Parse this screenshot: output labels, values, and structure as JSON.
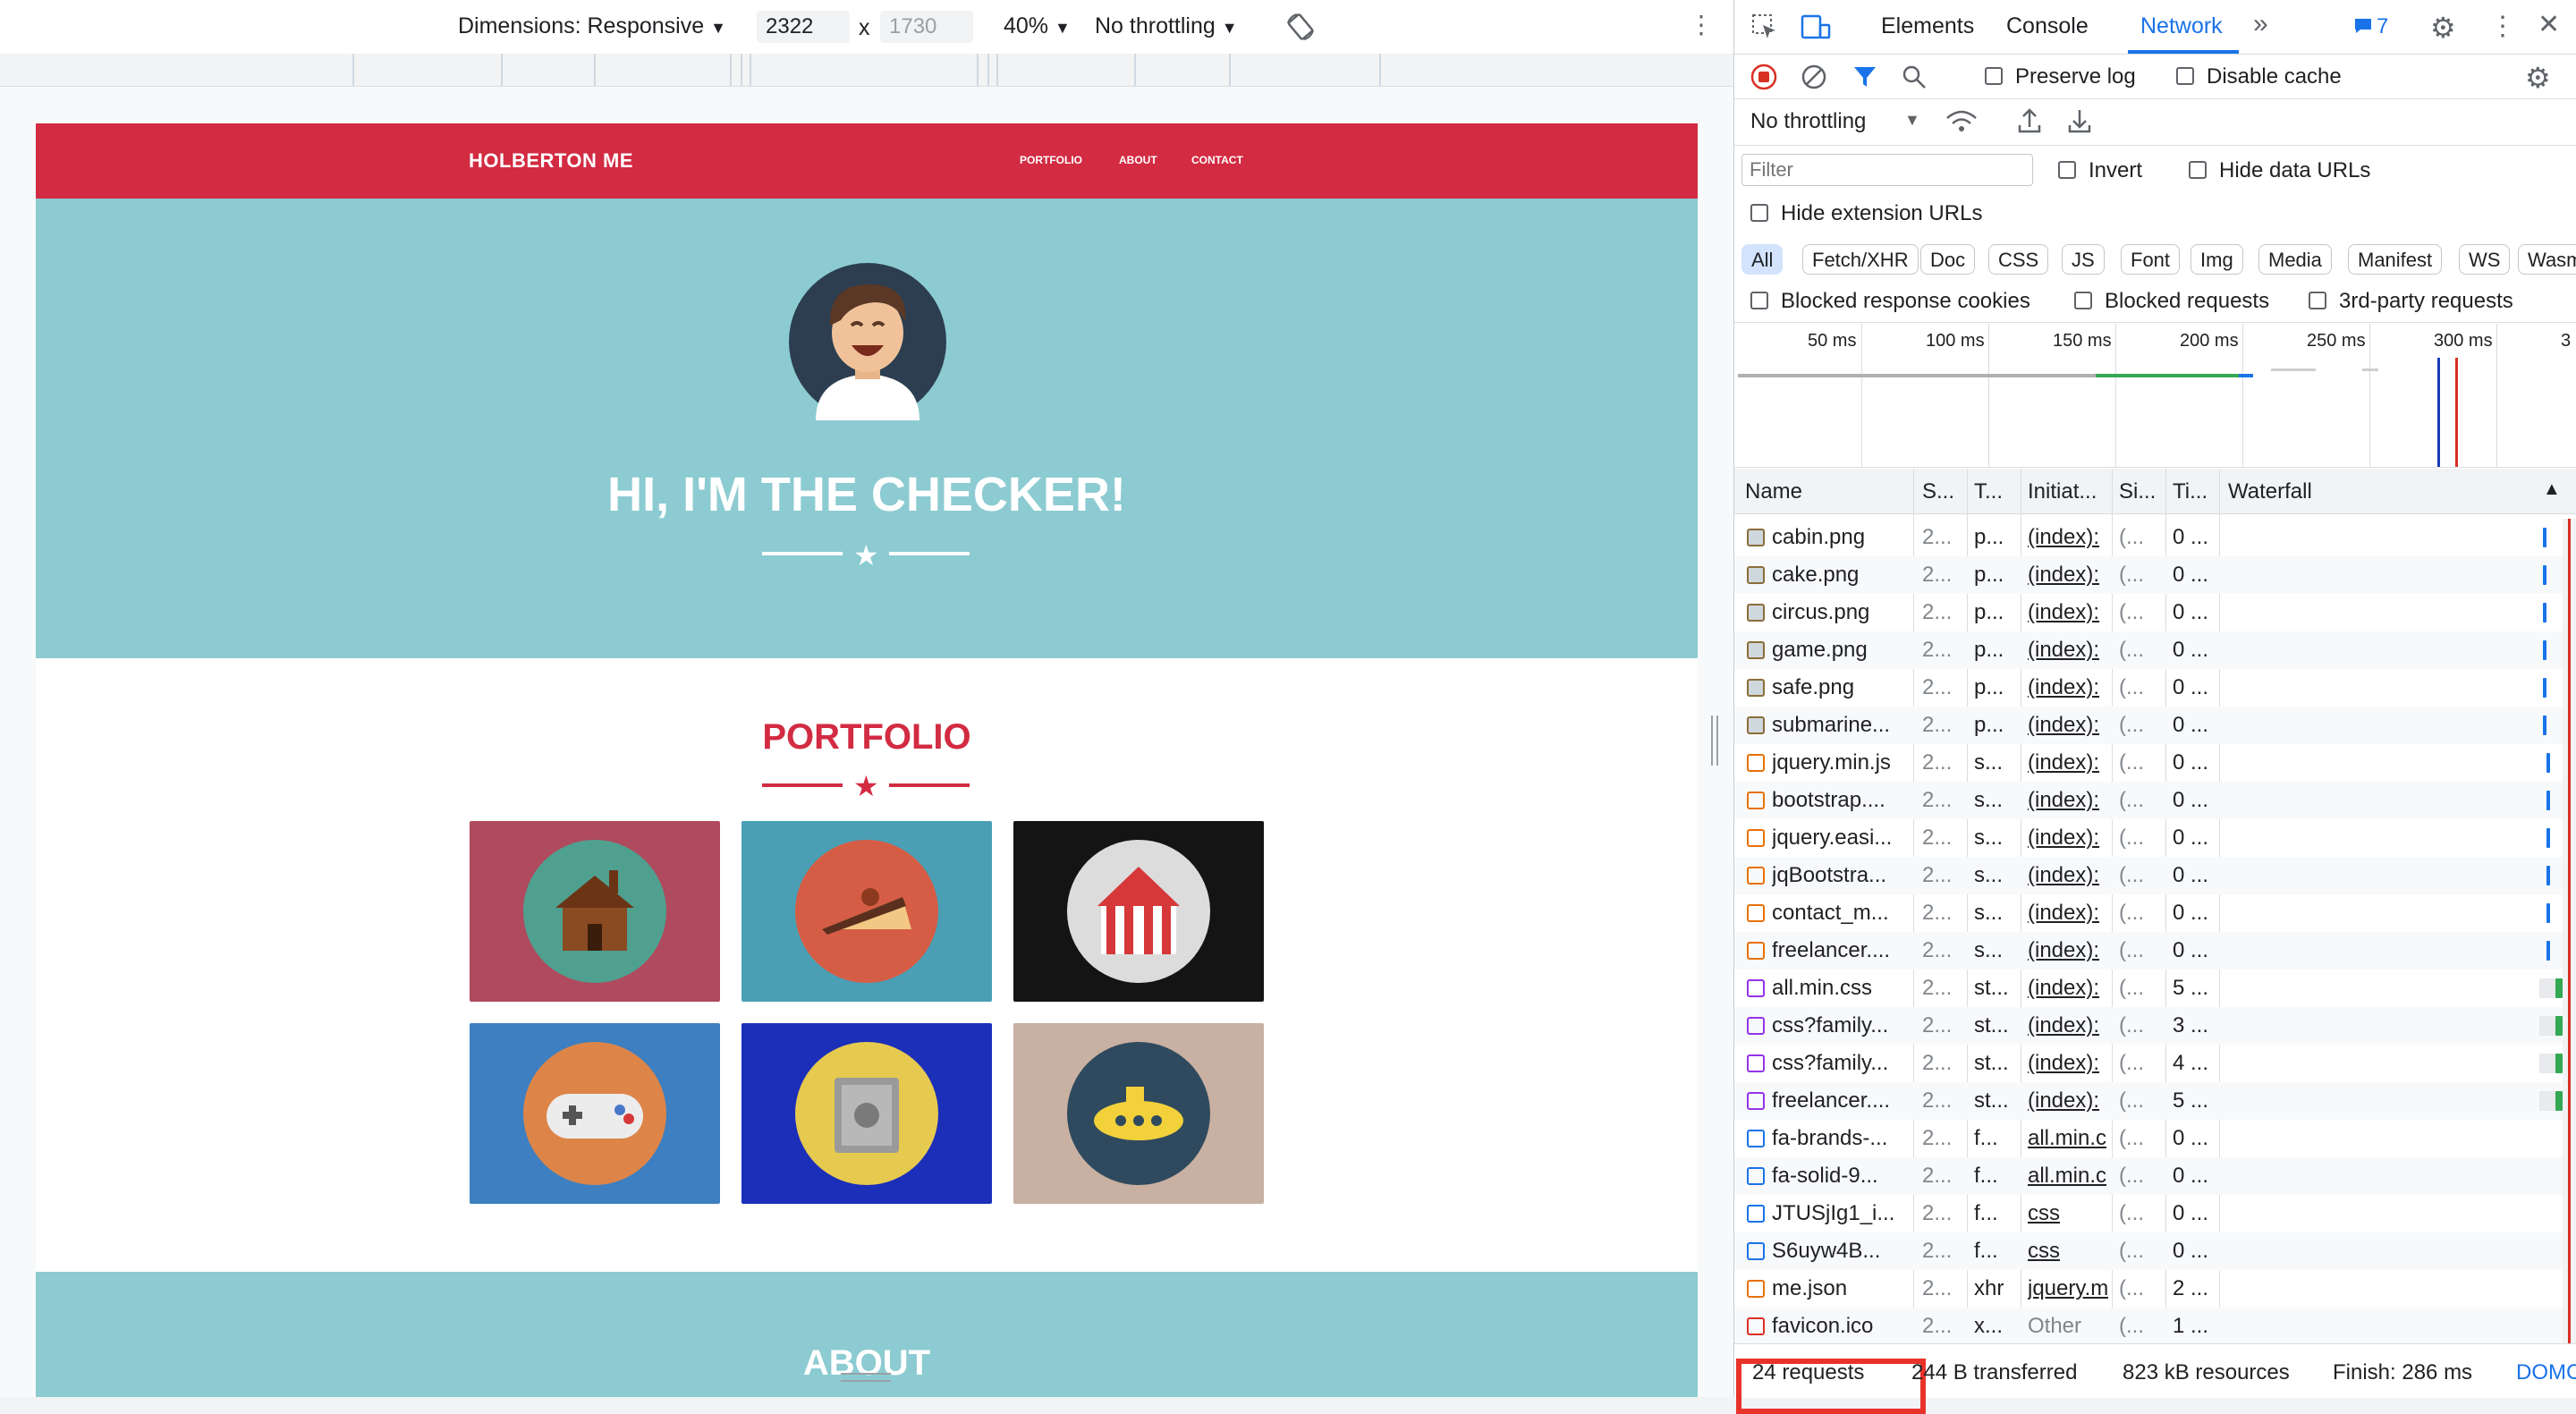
{
  "device_toolbar": {
    "dimensions_label": "Dimensions: Responsive",
    "width_value": "2322",
    "times": "x",
    "height_placeholder": "1730",
    "zoom": "40%",
    "throttling": "No throttling"
  },
  "site": {
    "brand": "HOLBERTON ME",
    "nav": [
      "PORTFOLIO",
      "ABOUT",
      "CONTACT"
    ],
    "hero_title": "HI, I'M THE CHECKER!",
    "portfolio_title": "PORTFOLIO",
    "about_title": "ABOUT",
    "tiles": [
      {
        "name": "cabin",
        "bg": "#b04a5e",
        "disc": "#4fa08f"
      },
      {
        "name": "cake",
        "bg": "#4a9fb5",
        "disc": "#d65d45"
      },
      {
        "name": "circus",
        "bg": "#141414",
        "disc": "#dcdcdc"
      },
      {
        "name": "game",
        "bg": "#3d7fc0",
        "disc": "#dd8548"
      },
      {
        "name": "safe",
        "bg": "#1c2fb8",
        "disc": "#e6c94f"
      },
      {
        "name": "submarine",
        "bg": "#c8b0a2",
        "disc": "#2f4a5e"
      }
    ],
    "colors": {
      "brand_red": "#d22b42",
      "hero_teal": "#8ccbd1"
    }
  },
  "devtools": {
    "tabs": [
      "Elements",
      "Console",
      "Network"
    ],
    "active_tab": "Network",
    "issues_count": "7",
    "preserve_log": "Preserve log",
    "disable_cache": "Disable cache",
    "throttling": "No throttling",
    "filter_placeholder": "Filter",
    "invert": "Invert",
    "hide_data_urls": "Hide data URLs",
    "hide_extension_urls": "Hide extension URLs",
    "type_filters": [
      "All",
      "Fetch/XHR",
      "Doc",
      "CSS",
      "JS",
      "Font",
      "Img",
      "Media",
      "Manifest",
      "WS",
      "Wasm"
    ],
    "blocked_cookies": "Blocked response cookies",
    "blocked_requests": "Blocked requests",
    "third_party": "3rd-party requests",
    "overview_ticks": [
      "50 ms",
      "100 ms",
      "150 ms",
      "200 ms",
      "250 ms",
      "300 ms",
      "3"
    ],
    "columns": [
      "Name",
      "S...",
      "T...",
      "Initiat...",
      "Si...",
      "Ti...",
      "Waterfall"
    ],
    "requests": [
      {
        "name": "cabin.png",
        "status": "2...",
        "type": "p...",
        "initiator": "(index):",
        "size": "(...",
        "time": "0 ...",
        "icon": "img"
      },
      {
        "name": "cake.png",
        "status": "2...",
        "type": "p...",
        "initiator": "(index):",
        "size": "(...",
        "time": "0 ...",
        "icon": "img"
      },
      {
        "name": "circus.png",
        "status": "2...",
        "type": "p...",
        "initiator": "(index):",
        "size": "(...",
        "time": "0 ...",
        "icon": "img"
      },
      {
        "name": "game.png",
        "status": "2...",
        "type": "p...",
        "initiator": "(index):",
        "size": "(...",
        "time": "0 ...",
        "icon": "img"
      },
      {
        "name": "safe.png",
        "status": "2...",
        "type": "p...",
        "initiator": "(index):",
        "size": "(...",
        "time": "0 ...",
        "icon": "img"
      },
      {
        "name": "submarine...",
        "status": "2...",
        "type": "p...",
        "initiator": "(index):",
        "size": "(...",
        "time": "0 ...",
        "icon": "img"
      },
      {
        "name": "jquery.min.js",
        "status": "2...",
        "type": "s...",
        "initiator": "(index):",
        "size": "(...",
        "time": "0 ...",
        "icon": "js"
      },
      {
        "name": "bootstrap....",
        "status": "2...",
        "type": "s...",
        "initiator": "(index):",
        "size": "(...",
        "time": "0 ...",
        "icon": "js"
      },
      {
        "name": "jquery.easi...",
        "status": "2...",
        "type": "s...",
        "initiator": "(index):",
        "size": "(...",
        "time": "0 ...",
        "icon": "js"
      },
      {
        "name": "jqBootstra...",
        "status": "2...",
        "type": "s...",
        "initiator": "(index):",
        "size": "(...",
        "time": "0 ...",
        "icon": "js"
      },
      {
        "name": "contact_m...",
        "status": "2...",
        "type": "s...",
        "initiator": "(index):",
        "size": "(...",
        "time": "0 ...",
        "icon": "js"
      },
      {
        "name": "freelancer....",
        "status": "2...",
        "type": "s...",
        "initiator": "(index):",
        "size": "(...",
        "time": "0 ...",
        "icon": "js"
      },
      {
        "name": "all.min.css",
        "status": "2...",
        "type": "st...",
        "initiator": "(index):",
        "size": "(...",
        "time": "5 ...",
        "icon": "css"
      },
      {
        "name": "css?family...",
        "status": "2...",
        "type": "st...",
        "initiator": "(index):",
        "size": "(...",
        "time": "3 ...",
        "icon": "css"
      },
      {
        "name": "css?family...",
        "status": "2...",
        "type": "st...",
        "initiator": "(index):",
        "size": "(...",
        "time": "4 ...",
        "icon": "css"
      },
      {
        "name": "freelancer....",
        "status": "2...",
        "type": "st...",
        "initiator": "(index):",
        "size": "(...",
        "time": "5 ...",
        "icon": "css"
      },
      {
        "name": "fa-brands-...",
        "status": "2...",
        "type": "f...",
        "initiator": "all.min.c",
        "size": "(...",
        "time": "0 ...",
        "icon": "font"
      },
      {
        "name": "fa-solid-9...",
        "status": "2...",
        "type": "f...",
        "initiator": "all.min.c",
        "size": "(...",
        "time": "0 ...",
        "icon": "font"
      },
      {
        "name": "JTUSjIg1_i...",
        "status": "2...",
        "type": "f...",
        "initiator": "css",
        "size": "(...",
        "time": "0 ...",
        "icon": "font"
      },
      {
        "name": "S6uyw4B...",
        "status": "2...",
        "type": "f...",
        "initiator": "css",
        "size": "(...",
        "time": "0 ...",
        "icon": "font"
      },
      {
        "name": "me.json",
        "status": "2...",
        "type": "xhr",
        "initiator": "jquery.m",
        "size": "(...",
        "time": "2 ...",
        "icon": "xhr"
      },
      {
        "name": "favicon.ico",
        "status": "2...",
        "type": "x...",
        "initiator": "Other",
        "size": "(...",
        "time": "1 ...",
        "icon": "other"
      }
    ],
    "status": {
      "requests": "24 requests",
      "transferred": "244 B transferred",
      "resources": "823 kB resources",
      "finish": "Finish: 286 ms",
      "dom": "DOMC"
    },
    "colors": {
      "accent": "#1a73e8",
      "highlight": "#e8332a"
    }
  }
}
